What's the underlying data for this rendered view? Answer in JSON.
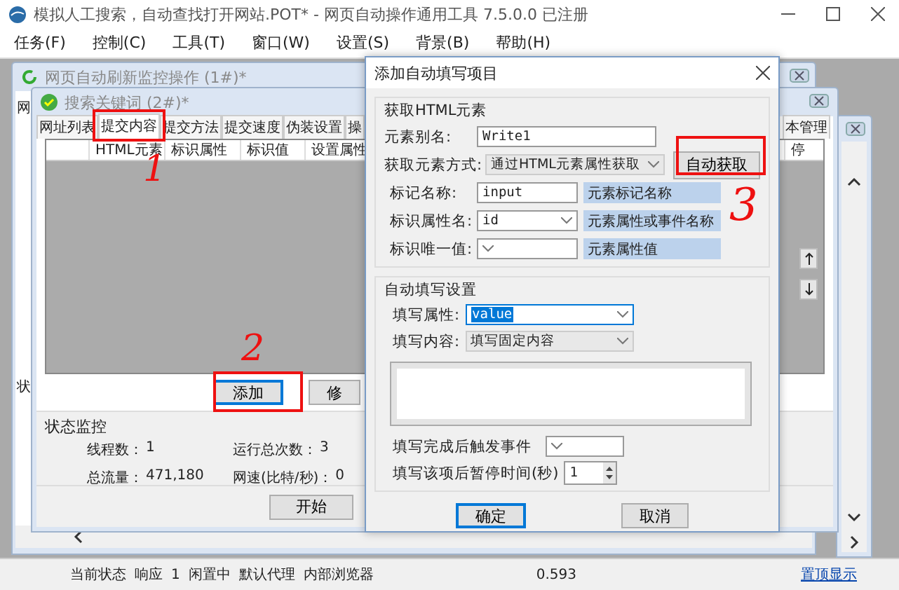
{
  "window": {
    "title": "模拟人工搜索，自动查找打开网站.POT* - 网页自动操作通用工具 7.5.0.0 已注册"
  },
  "menu": [
    "任务(F)",
    "控制(C)",
    "工具(T)",
    "窗口(W)",
    "设置(S)",
    "背景(B)",
    "帮助(H)"
  ],
  "back_window": {
    "title": "网页自动刷新监控操作 (1#)*",
    "tab": "网",
    "group": "状"
  },
  "front_window": {
    "title": "搜索关键词 (2#)*",
    "tabs": [
      {
        "label": "网址列表",
        "selected": false
      },
      {
        "label": "提交内容",
        "selected": true
      },
      {
        "label": "提交方法",
        "selected": false
      },
      {
        "label": "提交速度",
        "selected": false
      },
      {
        "label": "伪装设置",
        "selected": false
      },
      {
        "label": "操",
        "selected": false
      }
    ],
    "tabs_right": [
      {
        "label": "本管理",
        "selected": false
      }
    ],
    "columns": [
      "HTML元素",
      "标识属性",
      "标识值",
      "设置属性"
    ],
    "columns_right": [
      "停"
    ],
    "buttons": [
      "添加",
      "修"
    ],
    "status_monitor": {
      "title": "状态监控",
      "stats": [
        {
          "label": "线程数：",
          "value": "1"
        },
        {
          "label": "运行总次数：",
          "value": "3"
        },
        {
          "label": "总流量：",
          "value": "471,180"
        },
        {
          "label": "网速(比特/秒)：",
          "value": "0"
        }
      ]
    },
    "start_button": "开始"
  },
  "dialog": {
    "title": "添加自动填写项目",
    "element_group": {
      "title": "获取HTML元素",
      "alias": {
        "label": "元素别名:",
        "value": "Write1"
      },
      "method": {
        "label": "获取元素方式:",
        "value": "通过HTML元素属性获取"
      },
      "auto_button": "自动获取",
      "rows": [
        {
          "label": "标记名称:",
          "kind": "text",
          "value": "input",
          "hint": "元素标记名称"
        },
        {
          "label": "标识属性名:",
          "kind": "combo",
          "value": "id",
          "hint": "元素属性或事件名称"
        },
        {
          "label": "标识唯一值:",
          "kind": "combo",
          "hint": "元素属性值"
        }
      ]
    },
    "fill_group": {
      "title": "自动填写设置",
      "attribute": {
        "label": "填写属性:",
        "value": "value"
      },
      "content": {
        "label": "填写内容:",
        "value": "填写固定内容"
      },
      "trigger": {
        "label": "填写完成后触发事件"
      },
      "pause": {
        "label": "填写该项后暂停时间(秒)",
        "value": "1"
      }
    },
    "buttons": [
      "确定",
      "取消"
    ]
  },
  "status_bar": {
    "items": [
      "当前状态",
      "响应",
      "1",
      "闲置中",
      "默认代理",
      "内部浏览器"
    ],
    "reading": "0.593",
    "link": "置顶显示"
  },
  "annotations": [
    {
      "text": "1"
    },
    {
      "text": "2"
    },
    {
      "text": "3"
    }
  ]
}
